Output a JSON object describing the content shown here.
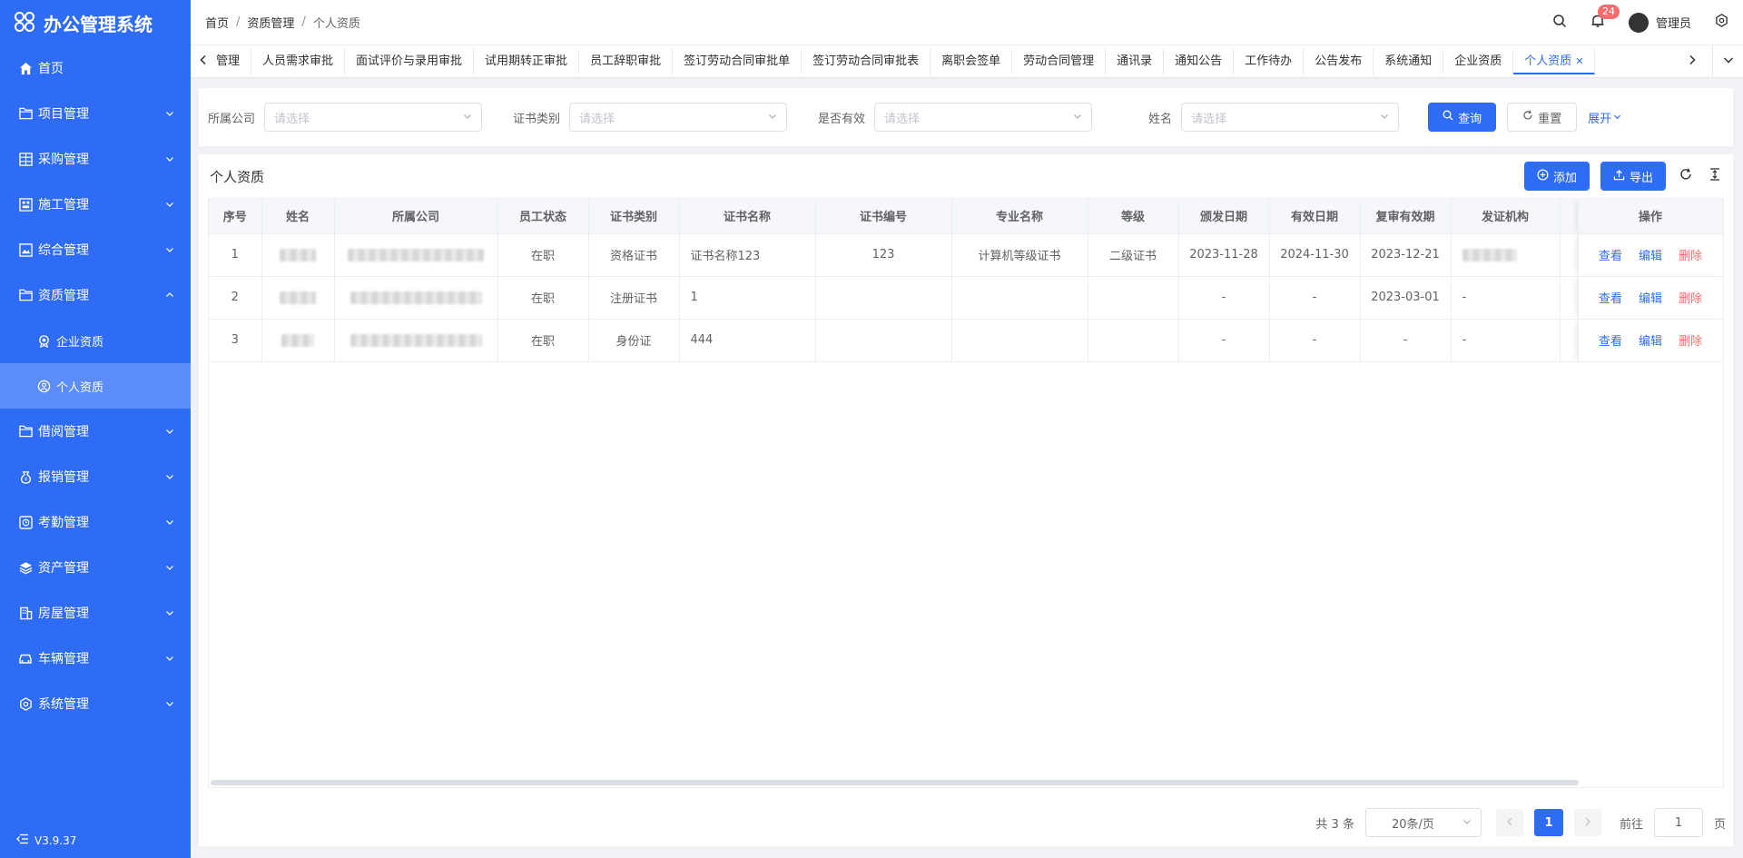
{
  "app": {
    "title": "办公管理系统",
    "version": "V3.9.37"
  },
  "sidebar": {
    "items": [
      {
        "label": "首页",
        "icon": "home-icon",
        "expandable": false
      },
      {
        "label": "项目管理",
        "icon": "folder-icon",
        "expandable": true
      },
      {
        "label": "采购管理",
        "icon": "grid-icon",
        "expandable": true
      },
      {
        "label": "施工管理",
        "icon": "construction-icon",
        "expandable": true
      },
      {
        "label": "综合管理",
        "icon": "picture-icon",
        "expandable": true
      },
      {
        "label": "资质管理",
        "icon": "folder-icon",
        "expandable": true,
        "expanded": true
      },
      {
        "label": "企业资质",
        "icon": "medal-icon",
        "sub": true
      },
      {
        "label": "个人资质",
        "icon": "person-badge-icon",
        "sub": true,
        "active": true
      },
      {
        "label": "借阅管理",
        "icon": "folder-icon",
        "expandable": true
      },
      {
        "label": "报销管理",
        "icon": "money-bag-icon",
        "expandable": true
      },
      {
        "label": "考勤管理",
        "icon": "clock-icon",
        "expandable": true
      },
      {
        "label": "资产管理",
        "icon": "layers-icon",
        "expandable": true
      },
      {
        "label": "房屋管理",
        "icon": "building-icon",
        "expandable": true
      },
      {
        "label": "车辆管理",
        "icon": "car-icon",
        "expandable": true
      },
      {
        "label": "系统管理",
        "icon": "gear-icon",
        "expandable": true
      }
    ]
  },
  "header": {
    "breadcrumb": [
      "首页",
      "资质管理",
      "个人资质"
    ],
    "notification_count": "24",
    "user_name": "管理员"
  },
  "tabs": [
    "管理",
    "人员需求审批",
    "面试评价与录用审批",
    "试用期转正审批",
    "员工辞职审批",
    "签订劳动合同审批单",
    "签订劳动合同审批表",
    "离职会签单",
    "劳动合同管理",
    "通讯录",
    "通知公告",
    "工作待办",
    "公告发布",
    "系统通知",
    "企业资质",
    "个人资质"
  ],
  "filter": {
    "fields": [
      {
        "label": "所属公司",
        "placeholder": "请选择"
      },
      {
        "label": "证书类别",
        "placeholder": "请选择"
      },
      {
        "label": "是否有效",
        "placeholder": "请选择"
      },
      {
        "label": "姓名",
        "placeholder": "请选择"
      }
    ],
    "search_label": "查询",
    "reset_label": "重置",
    "expand_label": "展开"
  },
  "main": {
    "title": "个人资质",
    "add_label": "添加",
    "export_label": "导出"
  },
  "table": {
    "columns": [
      "序号",
      "姓名",
      "所属公司",
      "员工状态",
      "证书类别",
      "证书名称",
      "证书编号",
      "专业名称",
      "等级",
      "颁发日期",
      "有效日期",
      "复审有效期",
      "发证机构",
      "操作"
    ],
    "rows": [
      {
        "no": "1",
        "status": "在职",
        "category": "资格证书",
        "cert_name": "证书名称123",
        "cert_no": "123",
        "major": "计算机等级证书",
        "level": "二级证书",
        "issue": "2023-11-28",
        "valid": "2024-11-30",
        "review": "2023-12-21",
        "issuer": ""
      },
      {
        "no": "2",
        "status": "在职",
        "category": "注册证书",
        "cert_name": "1",
        "cert_no": "",
        "major": "",
        "level": "",
        "issue": "-",
        "valid": "-",
        "review": "2023-03-01",
        "issuer": "-"
      },
      {
        "no": "3",
        "status": "在职",
        "category": "身份证",
        "cert_name": "444",
        "cert_no": "",
        "major": "",
        "level": "",
        "issue": "-",
        "valid": "-",
        "review": "-",
        "issuer": "-"
      }
    ],
    "actions": {
      "view": "查看",
      "edit": "编辑",
      "delete": "删除"
    }
  },
  "pagination": {
    "total_text": "共 3 条",
    "page_size": "20条/页",
    "current_page": "1",
    "goto_prefix": "前往",
    "goto_value": "1",
    "goto_suffix": "页"
  },
  "colors": {
    "primary": "#2f6cf6",
    "danger": "#f56c6c",
    "sidebar_active": "#5b8cf8"
  }
}
